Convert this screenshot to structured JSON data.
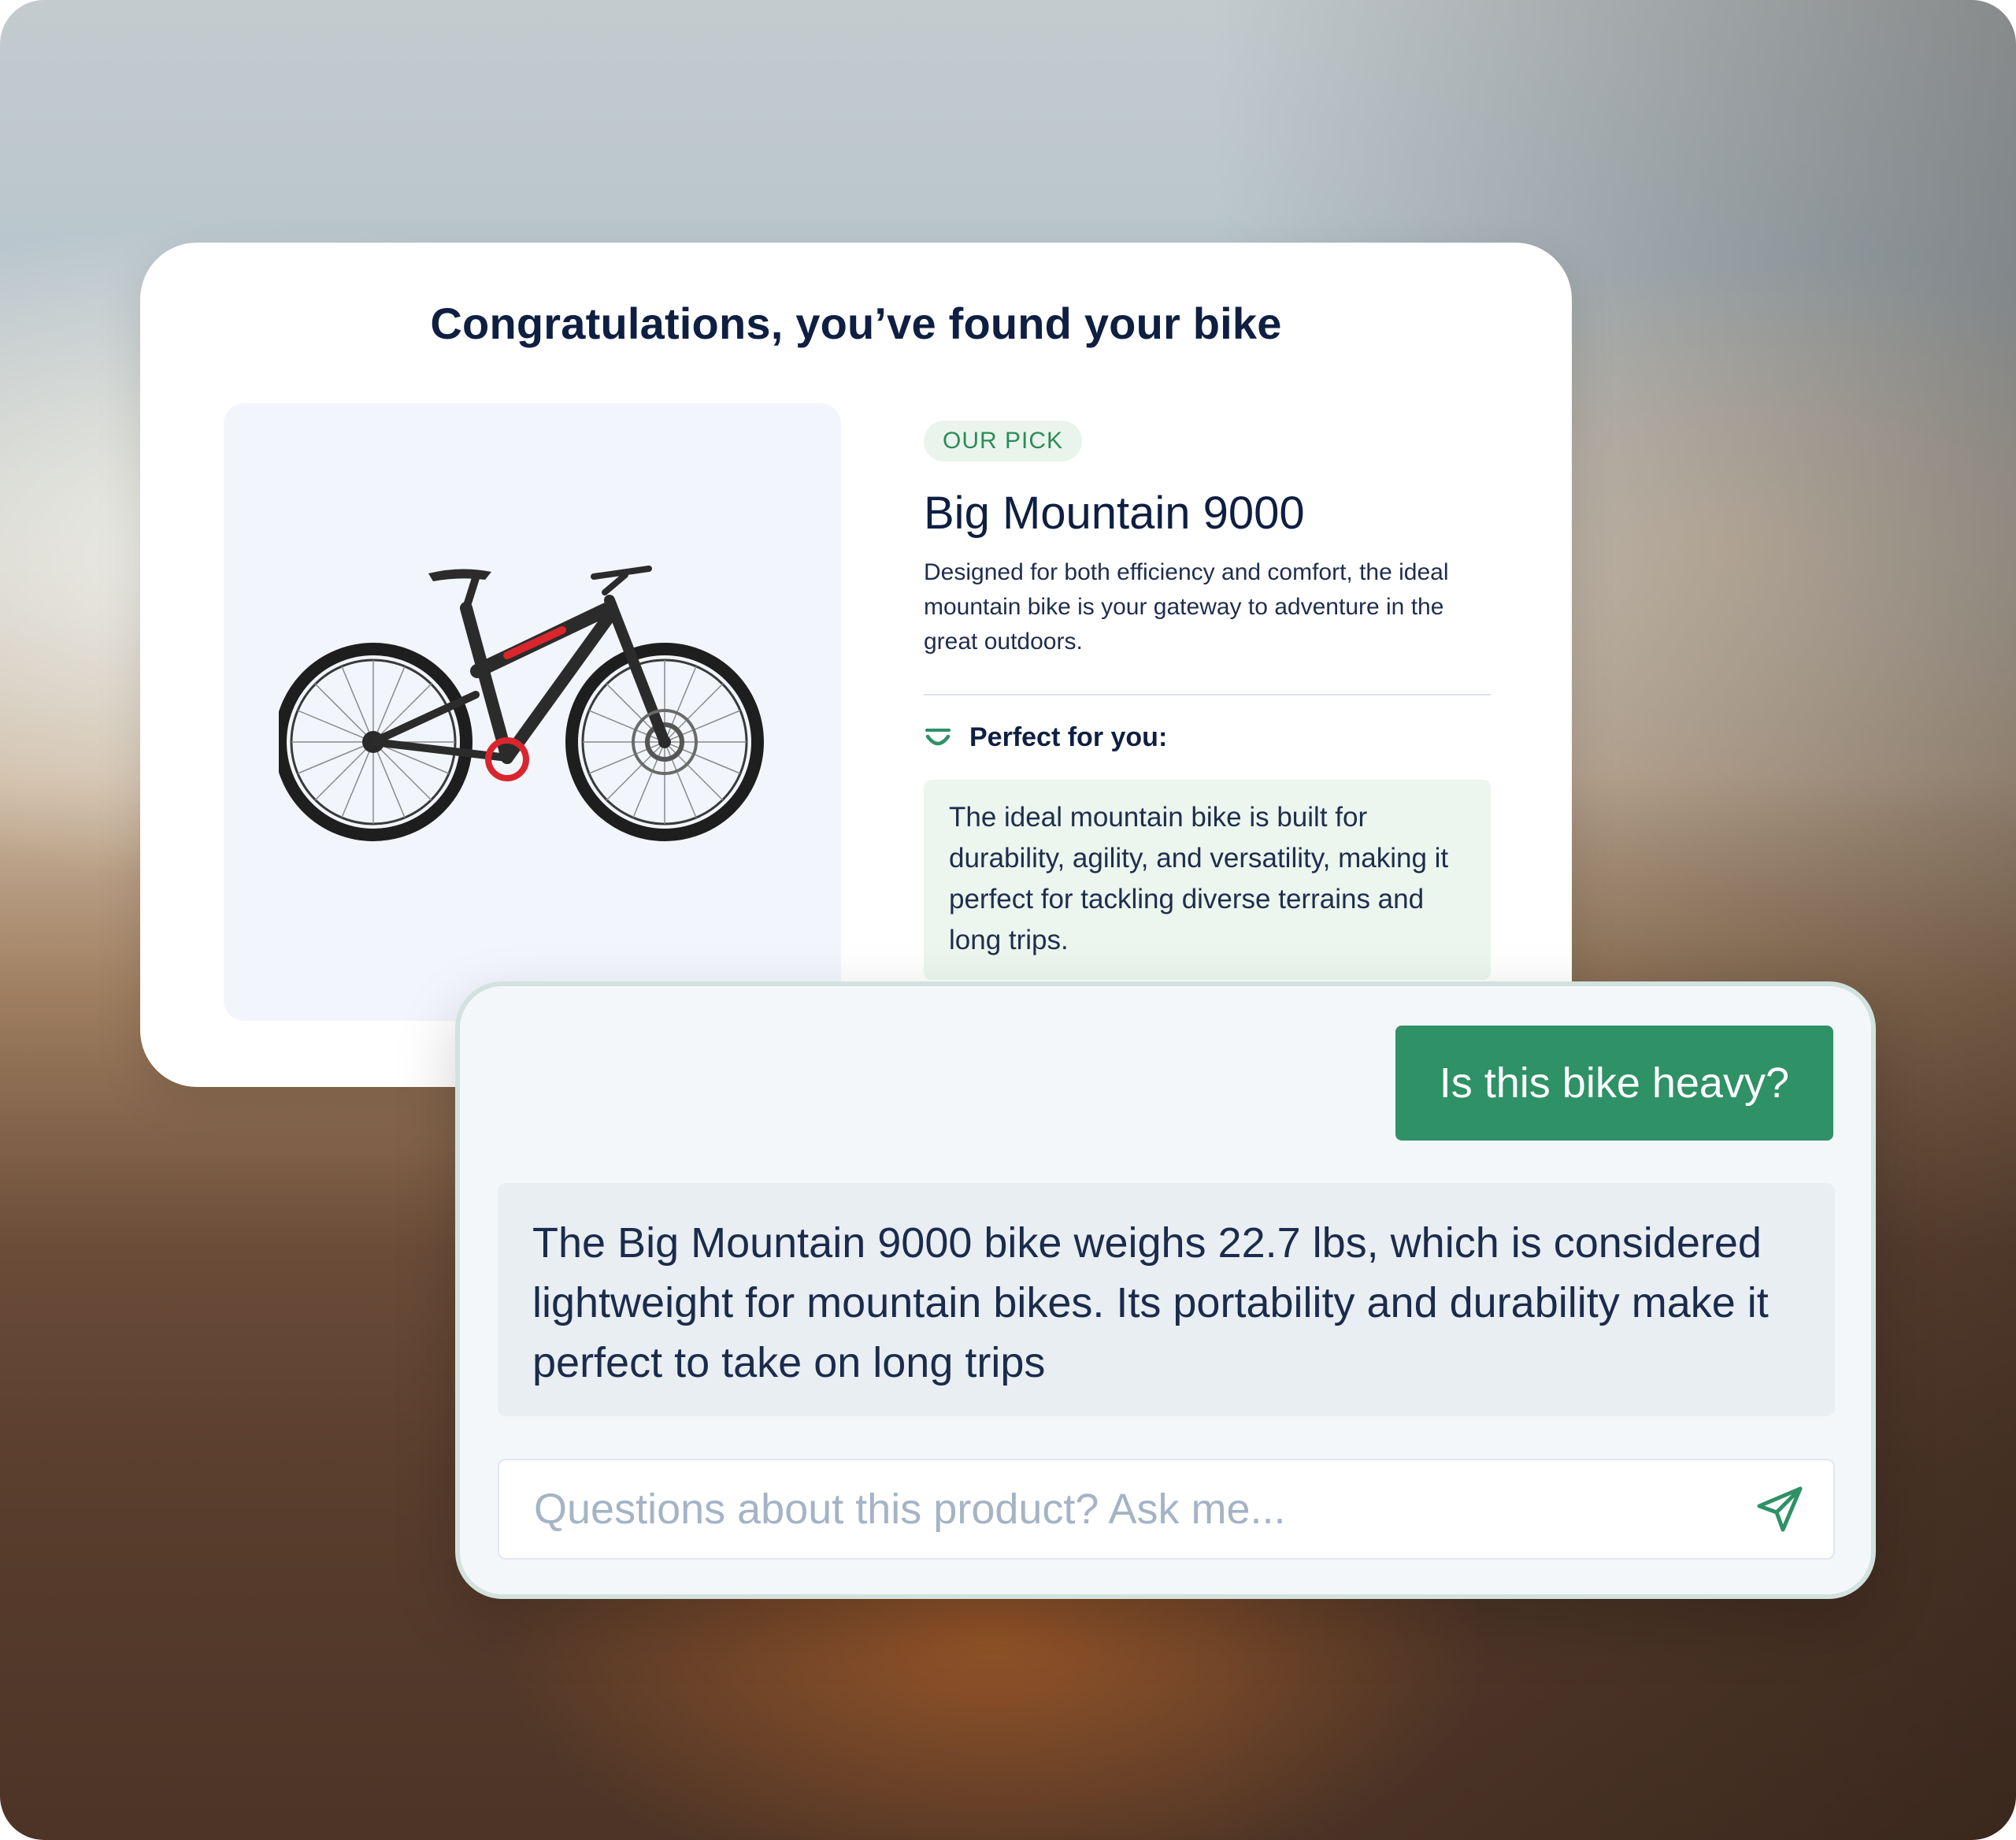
{
  "header": {
    "title": "Congratulations, you’ve found your bike"
  },
  "product": {
    "image_icon": "mountain-bike-image",
    "badge": "OUR PICK",
    "name": "Big Mountain 9000",
    "description": "Designed for both efficiency and comfort, the ideal mountain bike is your gateway to adventure in the great outdoors.",
    "perfect_label": "Perfect for you:",
    "perfect_icon": "smile-arc-icon",
    "perfect_text": "The ideal mountain bike is built for durability, agility, and versatility, making it perfect for tackling diverse terrains and long trips."
  },
  "chat": {
    "user_message": "Is this bike heavy?",
    "bot_message": "The Big Mountain 9000 bike weighs 22.7 lbs, which is considered lightweight for mountain bikes. Its portability and durability make it perfect to take on long trips",
    "input_value": "",
    "input_placeholder": "Questions about this product? Ask me...",
    "send_icon": "send-icon"
  },
  "colors": {
    "accent_green": "#2f9166",
    "badge_bg": "#e9f5ec",
    "navy_text": "#0f1f42"
  }
}
